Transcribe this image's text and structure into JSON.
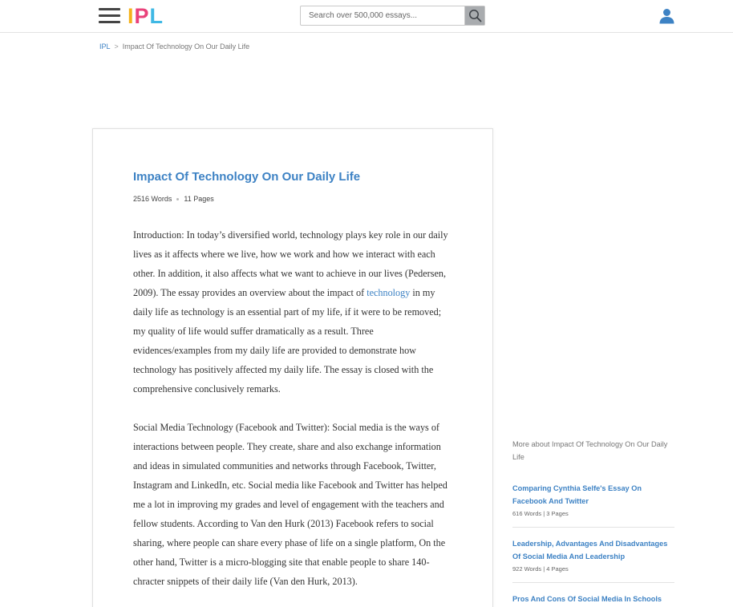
{
  "header": {
    "logo_text": [
      "I",
      "P",
      "L"
    ],
    "search_placeholder": "Search over 500,000 essays...",
    "colors": {
      "accent": "#3d82c4",
      "logo_i": "#f5b21b",
      "logo_p": "#e9417a",
      "logo_l": "#3fb8e4"
    }
  },
  "breadcrumb": {
    "home": "IPL",
    "separator": ">",
    "current": "Impact Of Technology On Our Daily Life"
  },
  "essay": {
    "title": "Impact Of Technology On Our Daily Life",
    "words": "2516 Words",
    "pages": "11 Pages",
    "p1_before": "Introduction: In today’s diversified world, technology plays key role in our daily lives as it affects where we live, how we work and how we interact with each other.  In addition, it also affects what we want to achieve in our lives (Pedersen, 2009). The essay provides an overview about the impact of ",
    "p1_link": "technology",
    "p1_after": " in my daily life as technology is an essential part of my life, if it were to be removed; my quality of life would suffer dramatically as a result. Three evidences/examples from my daily life are provided to demonstrate how technology has positively affected my daily life. The essay is closed with the comprehensive conclusively remarks.",
    "p2": "Social Media Technology (Facebook and Twitter): Social media is the ways of interactions between people. They create, share and also exchange information and ideas in simulated communities and networks through Facebook, Twitter, Instagram and LinkedIn, etc. Social media like Facebook and Twitter has helped me a lot in improving my grades and level of engagement with the teachers and fellow students. According to Van den Hurk (2013) Facebook refers to social sharing, where people can share every phase of life on a single platform, On the other hand, Twitter is a micro-blogging site that enable people to share 140-chracter snippets of their daily life (Van den Hurk, 2013)."
  },
  "sidebar": {
    "more_about": "More about Impact Of Technology On Our Daily Life",
    "related": [
      {
        "title": "Comparing Cynthia Selfe's Essay On Facebook And Twitter",
        "meta": "616 Words | 3 Pages"
      },
      {
        "title": "Leadership, Advantages And Disadvantages Of Social Media And Leadership",
        "meta": "922 Words | 4 Pages"
      },
      {
        "title": "Pros And Cons Of Social Media In Schools",
        "meta": ""
      }
    ]
  }
}
